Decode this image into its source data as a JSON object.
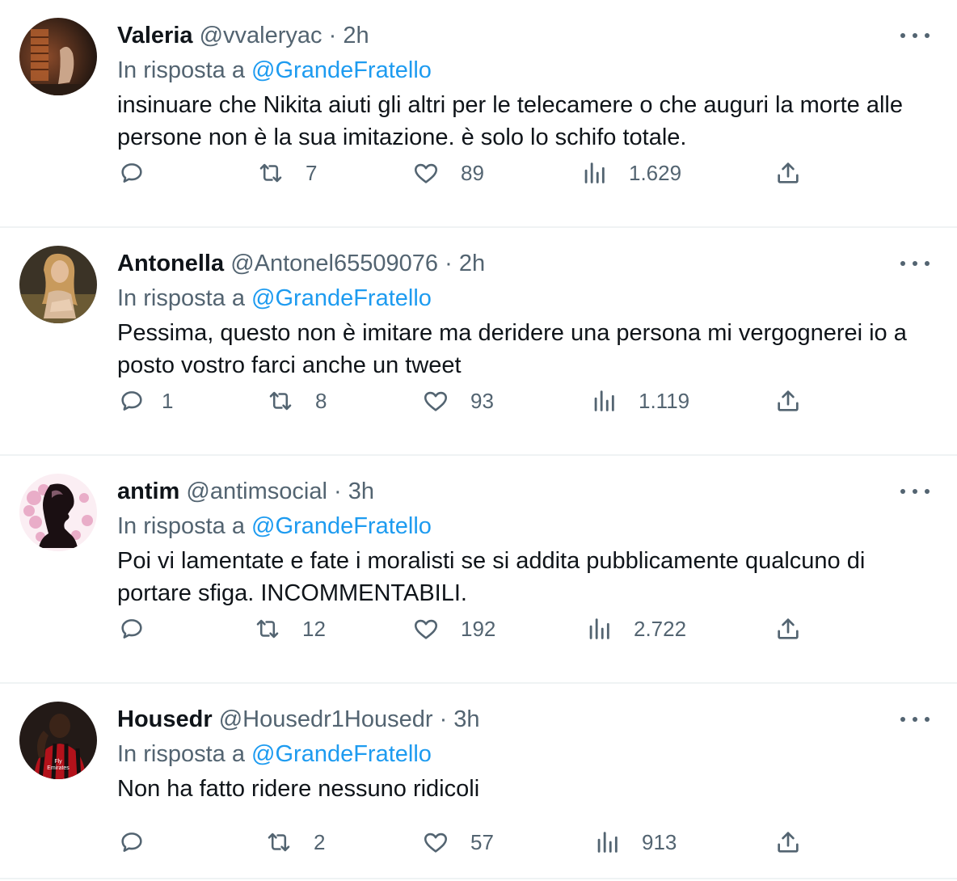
{
  "colors": {
    "link": "#1d9bf0",
    "muted": "#536471",
    "text": "#0f1419",
    "divider": "#eff3f4"
  },
  "tweets": [
    {
      "name": "Valeria",
      "handle": "@vvaleryac",
      "separator": "·",
      "time": "2h",
      "reply_prefix": "In risposta a",
      "reply_to": "@GrandeFratello",
      "text": "insinuare che Nikita aiuti gli altri per le telecamere o che auguri la morte alle persone non è la sua imitazione. è solo lo schifo totale.",
      "replies": "",
      "retweets": "7",
      "likes": "89",
      "views": "1.629",
      "avatar": "dark-room-photo"
    },
    {
      "name": "Antonella",
      "handle": "@Antonel65509076",
      "separator": "·",
      "time": "2h",
      "reply_prefix": "In risposta a",
      "reply_to": "@GrandeFratello",
      "text": "Pessima, questo non è imitare ma deridere una persona mi vergognerei io a posto vostro farci anche un tweet",
      "replies": "1",
      "retweets": "8",
      "likes": "93",
      "views": "1.119",
      "avatar": "woman-photo"
    },
    {
      "name": "antim",
      "handle": "@antimsocial",
      "separator": "·",
      "time": "3h",
      "reply_prefix": "In risposta a",
      "reply_to": "@GrandeFratello",
      "text": "Poi vi lamentate e fate i moralisti se si addita pubblicamente qualcuno di portare sfiga. INCOMMENTABILI.",
      "replies": "",
      "retweets": "12",
      "likes": "192",
      "views": "2.722",
      "avatar": "silhouette-illustration"
    },
    {
      "name": "Housedr",
      "handle": "@Housedr1Housedr",
      "separator": "·",
      "time": "3h",
      "reply_prefix": "In risposta a",
      "reply_to": "@GrandeFratello",
      "text": "Non ha fatto ridere nessuno ridicoli",
      "replies": "",
      "retweets": "2",
      "likes": "57",
      "views": "913",
      "avatar": "footballer-photo",
      "avatar_logo_text": "Fly Emirates"
    }
  ]
}
